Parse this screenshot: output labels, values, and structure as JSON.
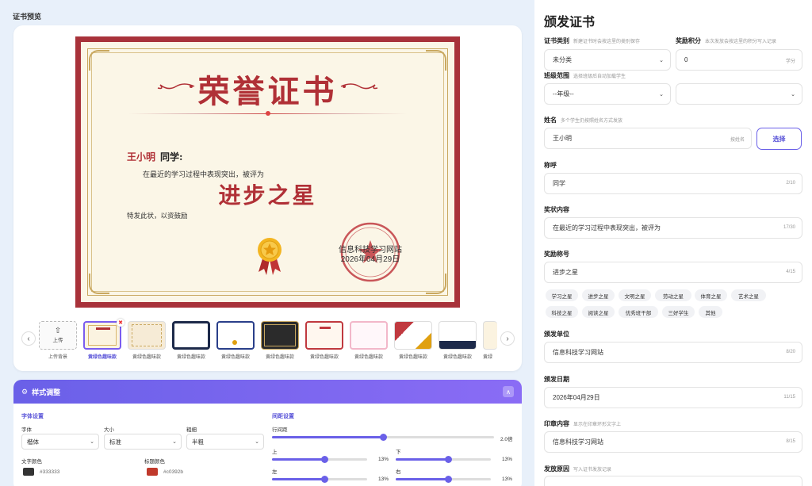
{
  "preview": {
    "section_title": "证书预览",
    "certificate": {
      "title": "荣誉证书",
      "recipient_name": "王小明",
      "honorific": "同学:",
      "body": "在最近的学习过程中表现突出，被评为",
      "award": "进步之星",
      "closing": "特发此状，以资鼓励",
      "issuer": "信息科技学习网站",
      "date": "2026年04月29日",
      "seal_text": "信息科技学习网站",
      "colors": {
        "frame": "#a8323a",
        "paper": "#fbf6e7",
        "title": "#b03036",
        "gold": "#c9a860"
      }
    },
    "thumbnails": {
      "prev_icon": "chevron-left-icon",
      "next_icon": "chevron-right-icon",
      "upload_label": "上传",
      "upload_caption": "上传背景",
      "items": [
        {
          "label": "黄绿色趣味款",
          "selected": true
        },
        {
          "label": "黄绿色趣味款"
        },
        {
          "label": "黄绿色趣味款"
        },
        {
          "label": "黄绿色趣味款"
        },
        {
          "label": "黄绿色趣味款"
        },
        {
          "label": "黄绿色趣味款"
        },
        {
          "label": "黄绿色趣味款"
        },
        {
          "label": "黄绿色趣味款"
        },
        {
          "label": "黄绿色趣味款"
        },
        {
          "label": "黄绿"
        }
      ]
    }
  },
  "style_panel": {
    "title": "样式调整",
    "font_settings": {
      "title": "字体设置",
      "font_label": "字体",
      "font_value": "楷体",
      "size_label": "大小",
      "size_value": "标准",
      "weight_label": "粗细",
      "weight_value": "半粗",
      "text_color_label": "文字颜色",
      "text_color": "#333333",
      "title_color_label": "标题颜色",
      "title_color": "#c0392b"
    },
    "spacing_settings": {
      "title": "间距设置",
      "line_height_label": "行间距",
      "line_height_value": "2.0倍",
      "line_height_fraction": 0.5,
      "top_label": "上",
      "top_value": "13%",
      "top_fraction": 0.55,
      "bottom_label": "下",
      "bottom_value": "13%",
      "bottom_fraction": 0.55,
      "left_label": "左",
      "left_value": "13%",
      "left_fraction": 0.55,
      "right_label": "右",
      "right_value": "13%",
      "right_fraction": 0.55
    }
  },
  "form": {
    "title": "颁发证书",
    "category": {
      "label": "证书类别",
      "hint": "新建证书时会按这里的类别保存",
      "value": "未分类"
    },
    "points": {
      "label": "奖励积分",
      "hint": "本次发放会按这里的积分写入记录",
      "value": "0",
      "unit": "学分"
    },
    "class_scope": {
      "label": "班级范围",
      "hint": "选择班级后自动加载学生",
      "grade_value": "--年级--",
      "class_value": ""
    },
    "name": {
      "label": "姓名",
      "hint": "多个学生仍按照姓名方式发放",
      "value": "王小明",
      "suffix": "按姓名",
      "pick_button": "选择"
    },
    "honorific": {
      "label": "称呼",
      "value": "同学",
      "count": "2/10"
    },
    "content": {
      "label": "奖状内容",
      "value": "在最近的学习过程中表现突出，被评为",
      "count": "17/30"
    },
    "award_title": {
      "label": "奖励称号",
      "value": "进步之星",
      "count": "4/15"
    },
    "award_tags": [
      "学习之星",
      "进步之星",
      "文明之星",
      "劳动之星",
      "体育之星",
      "艺术之星",
      "科技之星",
      "阅读之星",
      "优秀班干部",
      "三好学生",
      "其他"
    ],
    "issuer": {
      "label": "颁发单位",
      "value": "信息科技学习网站",
      "count": "8/20"
    },
    "date": {
      "label": "颁发日期",
      "value": "2026年04月29日",
      "count": "11/15"
    },
    "seal": {
      "label": "印章内容",
      "hint": "显示在印章环形文字上",
      "value": "信息科技学习网站",
      "count": "8/15"
    },
    "reason": {
      "label": "发放原因",
      "hint": "写入证书发放记录"
    }
  }
}
